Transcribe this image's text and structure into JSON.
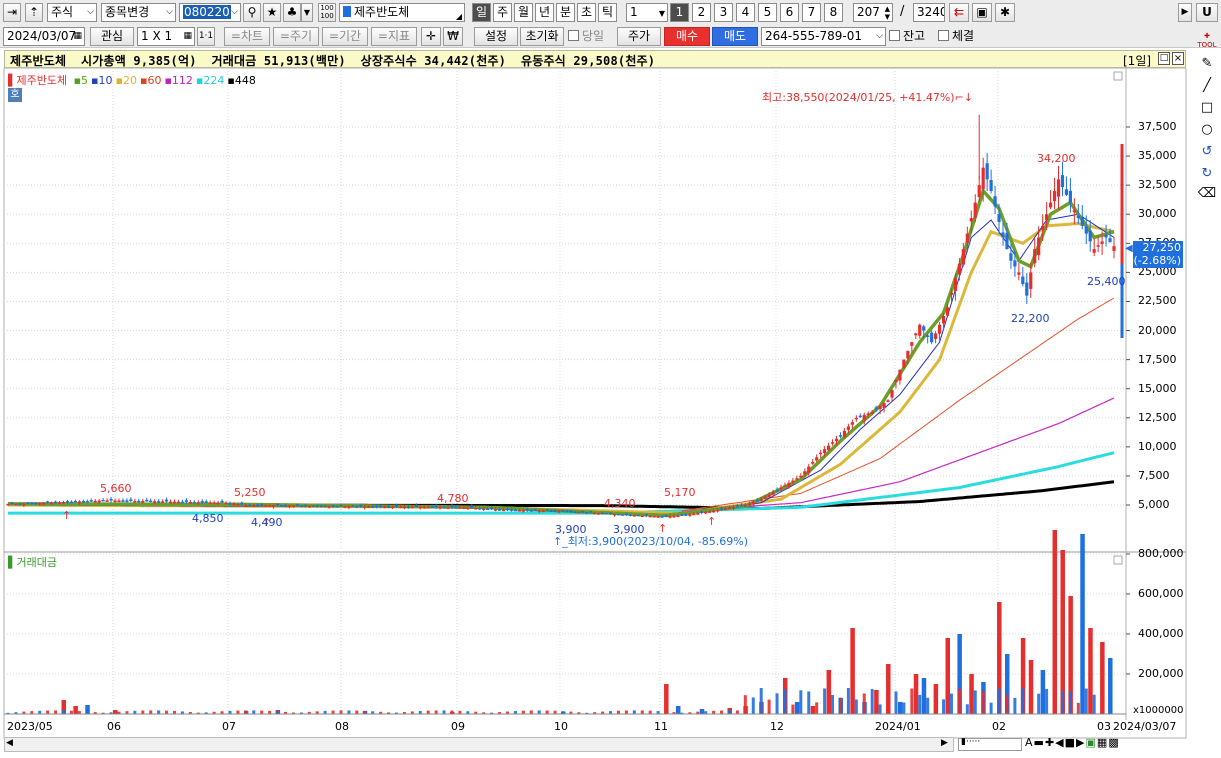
{
  "toolbar1": {
    "market": "주식",
    "change_code": "종목변경",
    "code": "080220",
    "name": "제주반도체",
    "periods": [
      "일",
      "주",
      "월",
      "년",
      "분",
      "초",
      "틱"
    ],
    "interval": "1",
    "slots": [
      "1",
      "2",
      "3",
      "4",
      "5",
      "6",
      "7",
      "8"
    ],
    "count": "207",
    "total": "3240",
    "right_btn": "U"
  },
  "toolbar2": {
    "date": "2024/03/07",
    "watch": "관심",
    "grid": "1 X 1",
    "grid_btn": "1·1",
    "chart": "=차트",
    "period": "=주기",
    "range": "=기간",
    "indicator": "=지표",
    "won": "₩",
    "setup": "설정",
    "reset": "초기화",
    "today": "당일",
    "price": "주가",
    "buy": "매수",
    "sell": "매도",
    "account": "264-555-789-01",
    "balance": "잔고",
    "filled": "체결"
  },
  "info": {
    "text": "제주반도체  시가총액 9,385(억)  거래대금 51,913(백만)  상장주식수 34,442(천주)  유동주식 29,508(천주)",
    "frame": "[1일]"
  },
  "legend": {
    "name": "제주반도체",
    "ma": [
      {
        "p": "5",
        "c": "#5b9f1f"
      },
      {
        "p": "10",
        "c": "#1f3fbf"
      },
      {
        "p": "20",
        "c": "#e0b030"
      },
      {
        "p": "60",
        "c": "#e0401f"
      },
      {
        "p": "112",
        "c": "#c020c0"
      },
      {
        "p": "224",
        "c": "#20d0d8"
      },
      {
        "p": "448",
        "c": "#000000"
      }
    ],
    "badge": "호"
  },
  "annotations": {
    "high": "최고:38,550(2024/01/25, +41.47%)",
    "low": "최저:3,900(2023/10/04, -85.69%)",
    "p34200": "34,200",
    "p22200": "22,200",
    "p25400": "25,400",
    "p5660": "5,660",
    "p5250": "5,250",
    "p4780": "4,780",
    "p4340": "4,340",
    "p5170": "5,170",
    "p4850": "4,850",
    "p4490": "4,490",
    "p3900a": "3,900",
    "p3900b": "3,900"
  },
  "current": {
    "price": "27,250",
    "change": "(-2.68%)"
  },
  "volume_label": "거래대금",
  "volume_unit": "x1000000",
  "x_axis": {
    "start": "2023/05",
    "end": "2024/03/07",
    "last": "03"
  },
  "colors": {
    "up": "#e62e2e",
    "down": "#1f6fe0",
    "ma5": "#6aa02a",
    "ma10": "#2030c0",
    "ma20": "#dcb83a",
    "ma60": "#e8502a",
    "ma112": "#c828c8",
    "ma224": "#2adce0",
    "ma448": "#000000"
  },
  "chart_data": {
    "type": "candlestick",
    "title": "제주반도체",
    "price_ticks": [
      "37,500",
      "35,000",
      "32,500",
      "30,000",
      "27,500",
      "25,000",
      "22,500",
      "20,000",
      "17,500",
      "15,000",
      "12,500",
      "10,000",
      "7,500",
      "5,000"
    ],
    "price_range": [
      2500,
      40500
    ],
    "volume_ticks": [
      "800,000",
      "600,000",
      "400,000",
      "200,000"
    ],
    "volume_range": [
      0,
      1000000
    ],
    "months": [
      "06",
      "07",
      "08",
      "09",
      "10",
      "11",
      "12",
      "2024/01",
      "02"
    ],
    "close_path": [
      [
        0,
        5100
      ],
      [
        10,
        5200
      ],
      [
        25,
        5400
      ],
      [
        40,
        5300
      ],
      [
        55,
        5200
      ],
      [
        60,
        5000
      ],
      [
        75,
        4950
      ],
      [
        85,
        4900
      ],
      [
        100,
        4850
      ],
      [
        115,
        4800
      ],
      [
        125,
        4600
      ],
      [
        140,
        4500
      ],
      [
        150,
        4300
      ],
      [
        160,
        4100
      ],
      [
        166,
        4000
      ],
      [
        172,
        4200
      ],
      [
        178,
        4500
      ],
      [
        182,
        4800
      ],
      [
        186,
        5000
      ],
      [
        190,
        5500
      ],
      [
        195,
        6500
      ],
      [
        200,
        7500
      ],
      [
        205,
        9500
      ],
      [
        210,
        11000
      ],
      [
        214,
        12500
      ],
      [
        218,
        13000
      ],
      [
        222,
        14000
      ],
      [
        226,
        17500
      ],
      [
        230,
        20500
      ],
      [
        233,
        19000
      ],
      [
        237,
        22000
      ],
      [
        241,
        27000
      ],
      [
        244,
        31000
      ],
      [
        246,
        34000
      ],
      [
        248,
        32000
      ],
      [
        251,
        28000
      ],
      [
        253,
        26000
      ],
      [
        255,
        25000
      ],
      [
        257,
        23000
      ],
      [
        259,
        27000
      ],
      [
        262,
        30000
      ],
      [
        265,
        33000
      ],
      [
        268,
        31000
      ],
      [
        271,
        29000
      ],
      [
        274,
        27000
      ],
      [
        277,
        28000
      ],
      [
        279,
        27250
      ]
    ],
    "ma": {
      "ma5": [
        [
          0,
          5100
        ],
        [
          60,
          5050
        ],
        [
          120,
          4800
        ],
        [
          166,
          4100
        ],
        [
          186,
          4900
        ],
        [
          200,
          7200
        ],
        [
          210,
          10500
        ],
        [
          220,
          13500
        ],
        [
          230,
          19000
        ],
        [
          236,
          21500
        ],
        [
          241,
          26500
        ],
        [
          246,
          32000
        ],
        [
          250,
          30500
        ],
        [
          255,
          26000
        ],
        [
          258,
          25500
        ],
        [
          263,
          30000
        ],
        [
          268,
          31000
        ],
        [
          274,
          28000
        ],
        [
          279,
          28500
        ]
      ],
      "ma10": [
        [
          0,
          5000
        ],
        [
          120,
          4800
        ],
        [
          166,
          4200
        ],
        [
          190,
          5200
        ],
        [
          205,
          8000
        ],
        [
          215,
          11500
        ],
        [
          225,
          14500
        ],
        [
          235,
          19000
        ],
        [
          243,
          28000
        ],
        [
          248,
          29500
        ],
        [
          255,
          26000
        ],
        [
          262,
          29500
        ],
        [
          270,
          30000
        ],
        [
          279,
          28000
        ]
      ],
      "ma20": [
        [
          0,
          5000
        ],
        [
          120,
          4800
        ],
        [
          170,
          4300
        ],
        [
          195,
          5500
        ],
        [
          210,
          8500
        ],
        [
          225,
          13000
        ],
        [
          235,
          17500
        ],
        [
          243,
          25000
        ],
        [
          248,
          28500
        ],
        [
          256,
          27500
        ],
        [
          262,
          29000
        ],
        [
          270,
          29200
        ],
        [
          279,
          28500
        ]
      ],
      "ma60": [
        [
          170,
          4500
        ],
        [
          200,
          6000
        ],
        [
          220,
          9000
        ],
        [
          240,
          14000
        ],
        [
          255,
          17500
        ],
        [
          270,
          21000
        ],
        [
          279,
          22800
        ]
      ],
      "ma112": [
        [
          170,
          4500
        ],
        [
          200,
          5200
        ],
        [
          225,
          7000
        ],
        [
          245,
          9500
        ],
        [
          265,
          12000
        ],
        [
          279,
          14200
        ]
      ],
      "ma224": [
        [
          0,
          4300
        ],
        [
          150,
          4300
        ],
        [
          200,
          4800
        ],
        [
          240,
          6500
        ],
        [
          265,
          8300
        ],
        [
          279,
          9500
        ]
      ],
      "ma448": [
        [
          0,
          5000
        ],
        [
          150,
          4950
        ],
        [
          190,
          4700
        ],
        [
          230,
          5300
        ],
        [
          260,
          6200
        ],
        [
          279,
          7000
        ]
      ]
    },
    "volume_bars": [
      [
        14,
        70000,
        1
      ],
      [
        17,
        40000,
        1
      ],
      [
        20,
        45000,
        0
      ],
      [
        27,
        20000,
        1
      ],
      [
        60,
        15000,
        0
      ],
      [
        68,
        20000,
        1
      ],
      [
        90,
        15000,
        0
      ],
      [
        112,
        10000,
        1
      ],
      [
        140,
        12000,
        0
      ],
      [
        166,
        150000,
        1
      ],
      [
        169,
        40000,
        0
      ],
      [
        175,
        25000,
        0
      ],
      [
        182,
        30000,
        1
      ],
      [
        186,
        40000,
        1
      ],
      [
        190,
        60000,
        1
      ],
      [
        196,
        180000,
        1
      ],
      [
        199,
        60000,
        0
      ],
      [
        203,
        40000,
        1
      ],
      [
        207,
        220000,
        1
      ],
      [
        210,
        80000,
        0
      ],
      [
        213,
        430000,
        1
      ],
      [
        216,
        60000,
        0
      ],
      [
        219,
        120000,
        1
      ],
      [
        222,
        250000,
        1
      ],
      [
        225,
        60000,
        0
      ],
      [
        229,
        200000,
        1
      ],
      [
        231,
        180000,
        0
      ],
      [
        234,
        150000,
        1
      ],
      [
        237,
        380000,
        1
      ],
      [
        240,
        400000,
        0
      ],
      [
        243,
        200000,
        1
      ],
      [
        246,
        160000,
        0
      ],
      [
        250,
        560000,
        1
      ],
      [
        252,
        300000,
        0
      ],
      [
        256,
        380000,
        1
      ],
      [
        258,
        270000,
        1
      ],
      [
        261,
        220000,
        0
      ],
      [
        264,
        920000,
        1
      ],
      [
        266,
        820000,
        1
      ],
      [
        268,
        590000,
        1
      ],
      [
        271,
        900000,
        0
      ],
      [
        273,
        430000,
        1
      ],
      [
        276,
        360000,
        1
      ],
      [
        278,
        280000,
        0
      ]
    ]
  }
}
